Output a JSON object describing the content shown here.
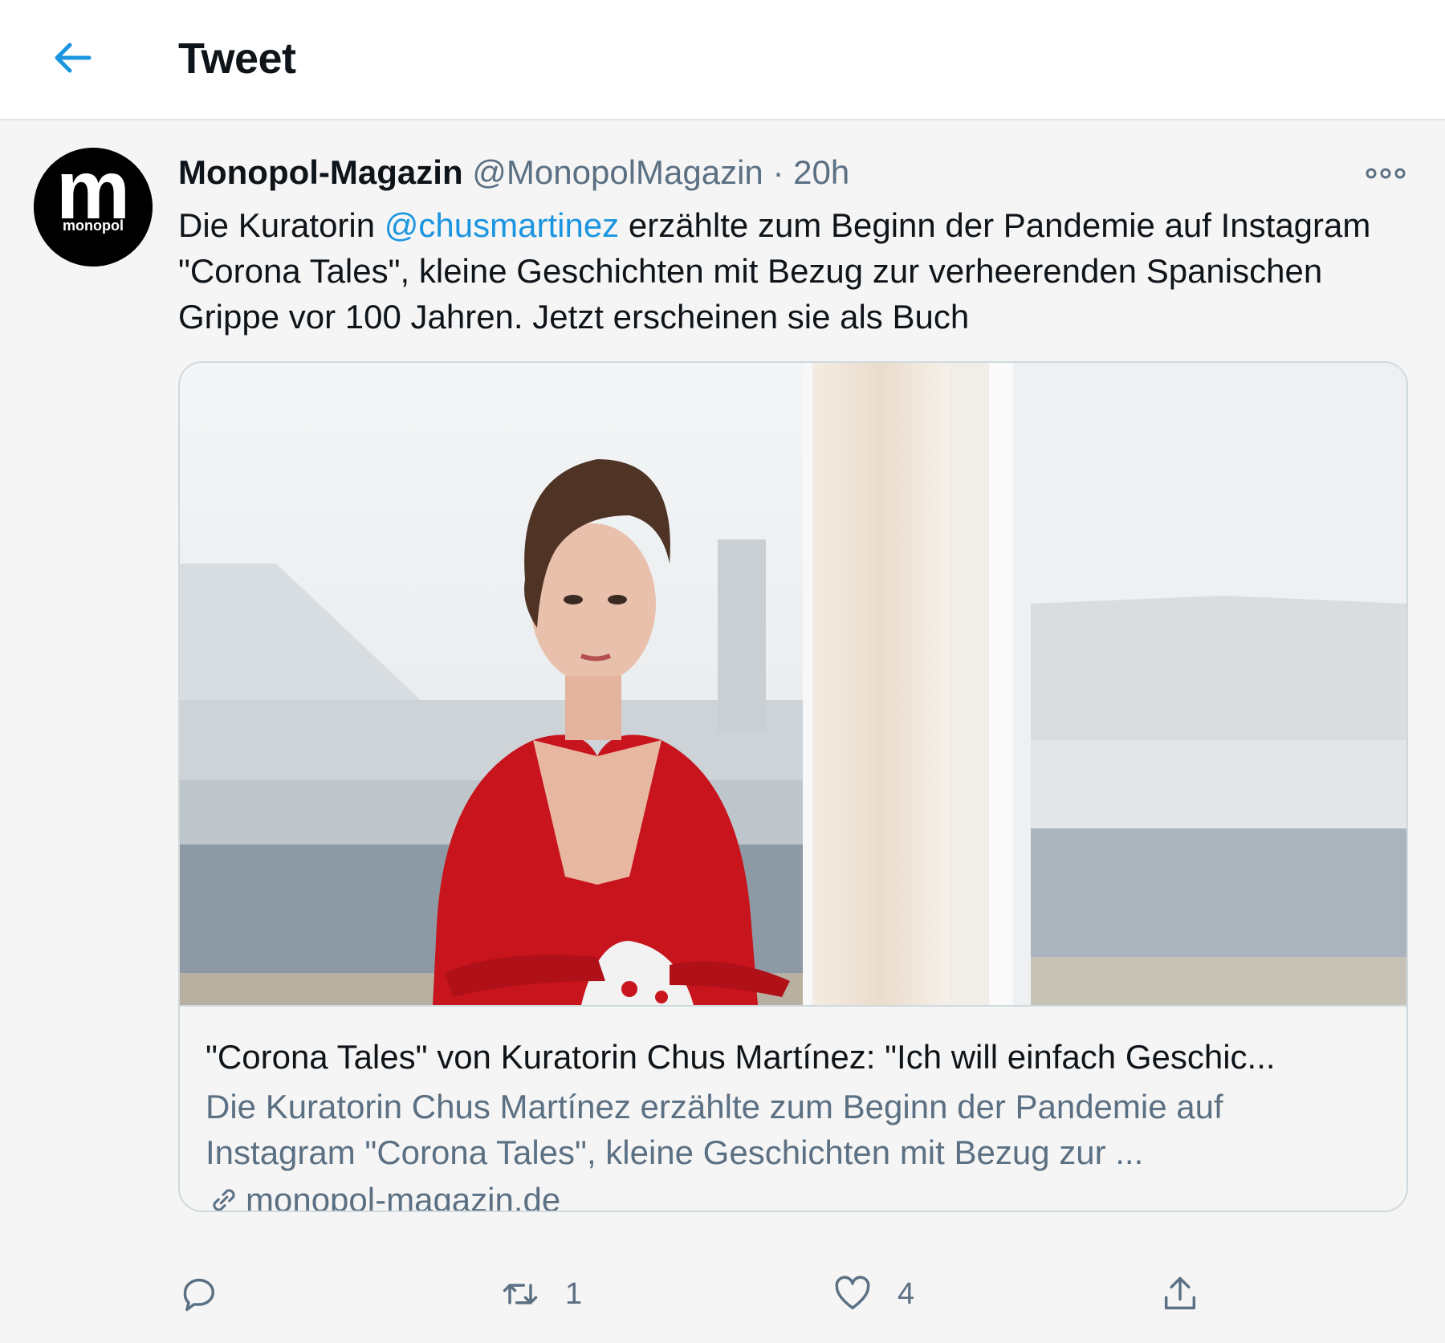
{
  "header": {
    "title": "Tweet",
    "back_icon": "arrow-left-icon"
  },
  "tweet": {
    "author": {
      "name": "Monopol-Magazin",
      "handle": "@MonopolMagazin",
      "avatar_text": "monopol",
      "avatar_letter": "m"
    },
    "separator": "·",
    "time": "20h",
    "text": {
      "before_mention": "Die Kuratorin ",
      "mention": "@chusmartinez",
      "after_mention": " erzählte zum Beginn der Pandemie auf Instagram \"Corona Tales\", kleine Geschichten mit Bezug zur verheerenden Spanischen Grippe vor 100 Jahren. Jetzt erscheinen sie als Buch"
    },
    "card": {
      "title": "\"Corona Tales\" von Kuratorin Chus Martínez: \"Ich will einfach Geschic...",
      "description": "Die Kuratorin Chus Martínez erzählte zum Beginn der Pandemie auf Instagram \"Corona Tales\", kleine Geschichten mit Bezug zur ...",
      "domain": "monopol-magazin.de",
      "link_icon": "link-icon"
    },
    "actions": {
      "reply": {
        "icon": "reply-icon",
        "count": ""
      },
      "retweet": {
        "icon": "retweet-icon",
        "count": "1"
      },
      "like": {
        "icon": "heart-icon",
        "count": "4"
      },
      "share": {
        "icon": "share-icon",
        "count": ""
      }
    }
  },
  "colors": {
    "accent": "#1b95e0",
    "secondary_text": "#5b7083",
    "background": "#f5f5f5",
    "shirt_red": "#c8141c"
  }
}
